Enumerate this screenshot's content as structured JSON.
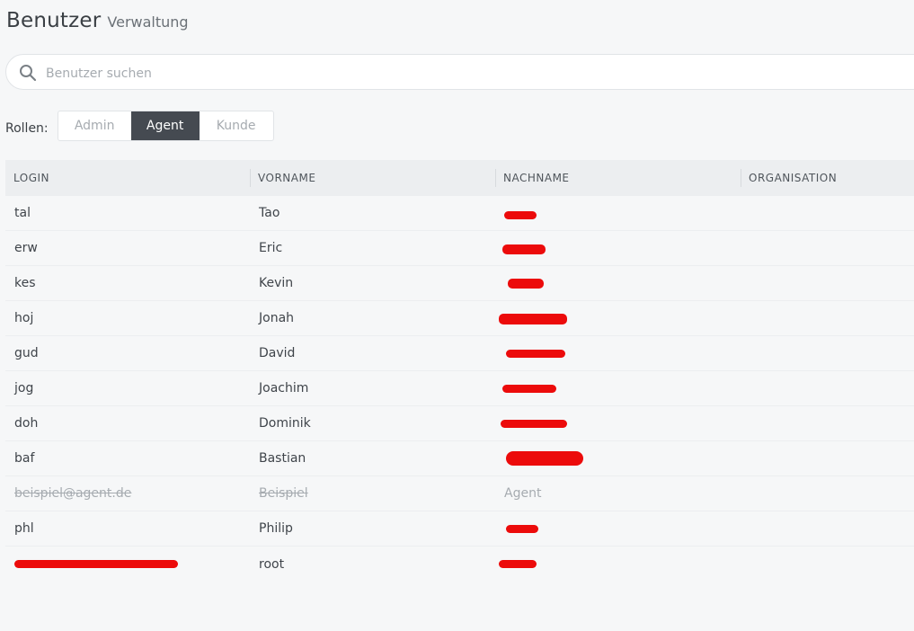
{
  "header": {
    "title": "Benutzer",
    "subtitle": "Verwaltung"
  },
  "search": {
    "placeholder": "Benutzer suchen",
    "value": ""
  },
  "roles": {
    "label": "Rollen:",
    "options": [
      "Admin",
      "Agent",
      "Kunde"
    ],
    "selected": "Agent"
  },
  "table": {
    "columns": [
      "LOGIN",
      "VORNAME",
      "NACHNAME",
      "ORGANISATION"
    ],
    "rows": [
      {
        "login": "tal",
        "vorname": "Tao",
        "nachname": "",
        "organisation": "",
        "inactive": false
      },
      {
        "login": "erw",
        "vorname": "Eric",
        "nachname": "",
        "organisation": "",
        "inactive": false
      },
      {
        "login": "kes",
        "vorname": "Kevin",
        "nachname": "",
        "organisation": "",
        "inactive": false
      },
      {
        "login": "hoj",
        "vorname": "Jonah",
        "nachname": "",
        "organisation": "",
        "inactive": false
      },
      {
        "login": "gud",
        "vorname": "David",
        "nachname": "",
        "organisation": "",
        "inactive": false
      },
      {
        "login": "jog",
        "vorname": "Joachim",
        "nachname": "",
        "organisation": "",
        "inactive": false
      },
      {
        "login": "doh",
        "vorname": "Dominik",
        "nachname": "",
        "organisation": "",
        "inactive": false
      },
      {
        "login": "baf",
        "vorname": "Bastian",
        "nachname": "",
        "organisation": "",
        "inactive": false
      },
      {
        "login": "beispiel@agent.de",
        "vorname": "Beispiel",
        "nachname": "Agent",
        "organisation": "",
        "inactive": true
      },
      {
        "login": "phl",
        "vorname": "Philip",
        "nachname": "",
        "organisation": "",
        "inactive": false
      },
      {
        "login": "",
        "vorname": "root",
        "nachname": "",
        "organisation": "",
        "inactive": false
      }
    ]
  },
  "colors": {
    "background": "#f6f7f8",
    "selected_segment": "#454a51",
    "redaction": "#ec0b0b"
  }
}
